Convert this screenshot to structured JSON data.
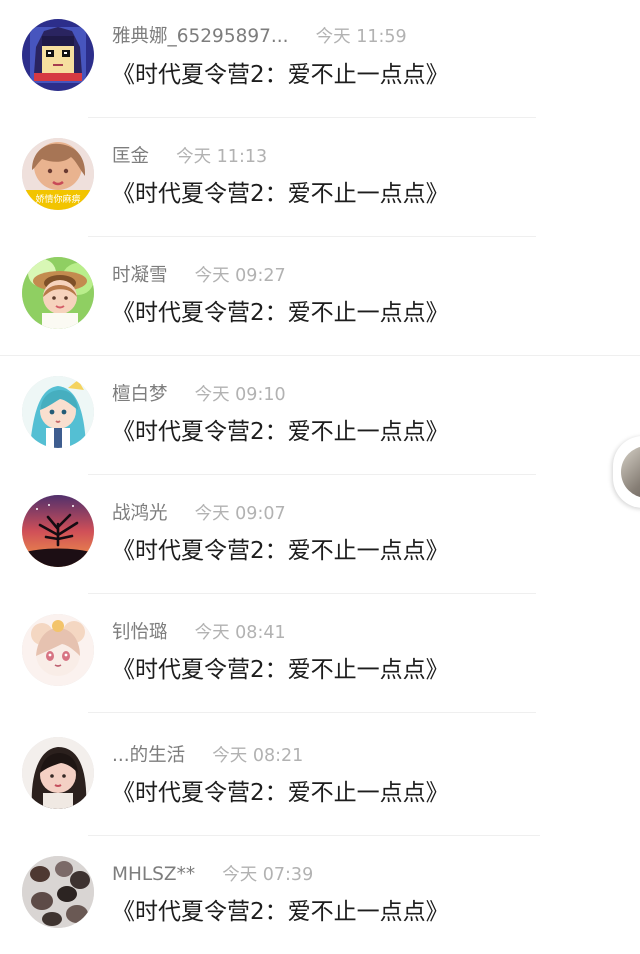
{
  "comments": [
    {
      "name": "雅典娜_65295897...",
      "time": "今天 11:59",
      "message": "《时代夏令营2：爱不止一点点》",
      "avatar": "pixel-girl-avatar"
    },
    {
      "name": "匡金",
      "time": "今天 11:13",
      "message": "《时代夏令营2：爱不止一点点》",
      "avatar": "girl-photo-avatar"
    },
    {
      "name": "时凝雪",
      "time": "今天 09:27",
      "message": "《时代夏令营2：爱不止一点点》",
      "avatar": "hat-girl-avatar"
    },
    {
      "name": "檀白梦",
      "time": "今天 09:10",
      "message": "《时代夏令营2：爱不止一点点》",
      "avatar": "anime-girl-avatar"
    },
    {
      "name": "战鸿光",
      "time": "今天 09:07",
      "message": "《时代夏令营2：爱不止一点点》",
      "avatar": "tree-sunset-avatar"
    },
    {
      "name": "钊怡璐",
      "time": "今天 08:41",
      "message": "《时代夏令营2：爱不止一点点》",
      "avatar": "cute-chibi-avatar"
    },
    {
      "name": "...的生活",
      "time": "今天 08:21",
      "message": "《时代夏令营2：爱不止一点点》",
      "avatar": "woman-portrait-avatar"
    },
    {
      "name": "MHLSZ**",
      "time": "今天 07:39",
      "message": "《时代夏令营2：爱不止一点点》",
      "avatar": "pattern-avatar"
    }
  ],
  "avatar_badge_text": "娇情你麻痹",
  "floating_avatar": "floating-user-avatar"
}
